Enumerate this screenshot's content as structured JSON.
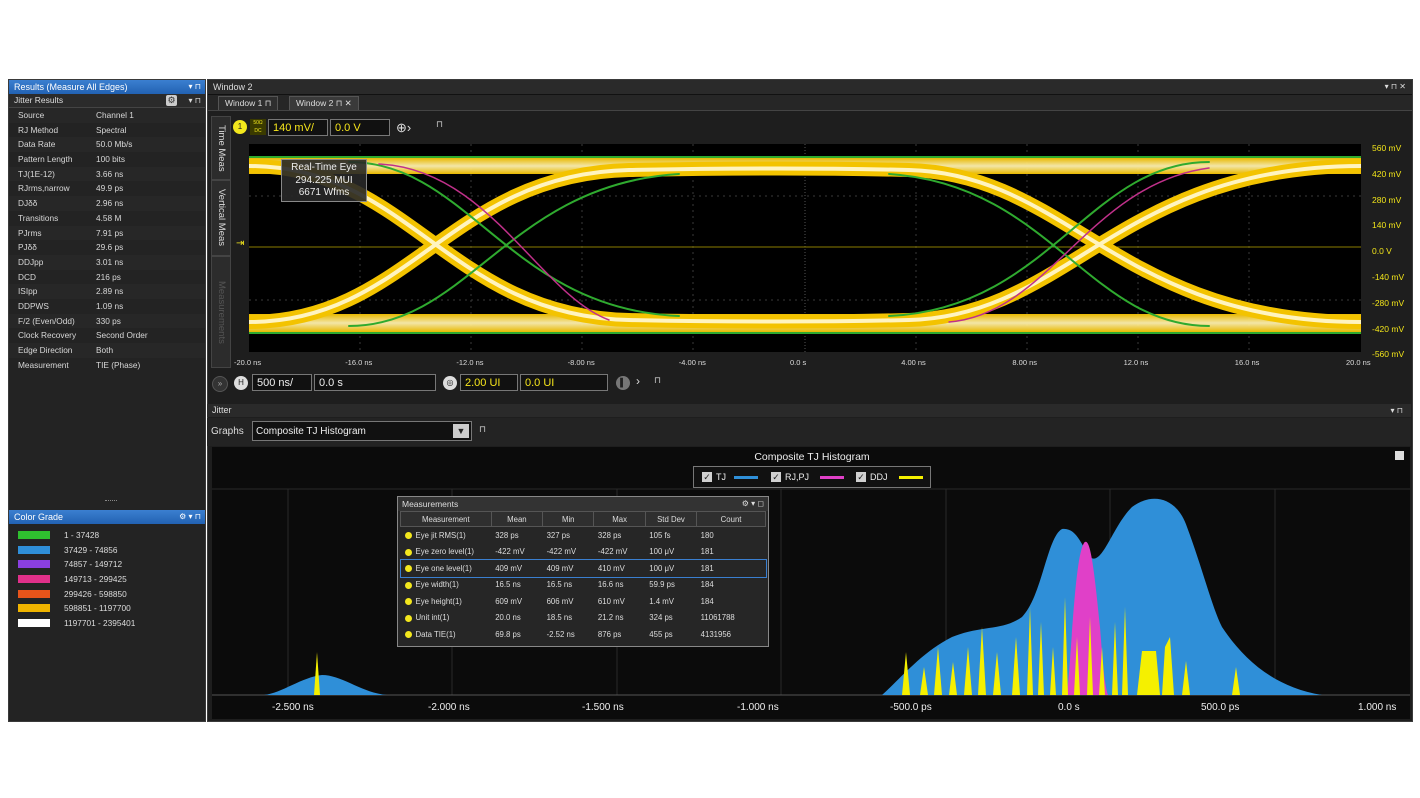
{
  "results_panel": {
    "title": "Results  (Measure All Edges)",
    "subheader": "Jitter Results",
    "rows": [
      {
        "label": "Source",
        "value": "Channel 1"
      },
      {
        "label": "RJ Method",
        "value": "Spectral"
      },
      {
        "label": "Data Rate",
        "value": "50.0 Mb/s"
      },
      {
        "label": "Pattern Length",
        "value": "100 bits"
      },
      {
        "label": "TJ(1E-12)",
        "value": "3.66 ns"
      },
      {
        "label": "RJrms,narrow",
        "value": "49.9 ps"
      },
      {
        "label": "DJδδ",
        "value": "2.96 ns"
      },
      {
        "label": "Transitions",
        "value": "4.58 M"
      },
      {
        "label": "PJrms",
        "value": "7.91 ps"
      },
      {
        "label": "PJδδ",
        "value": "29.6 ps"
      },
      {
        "label": "DDJpp",
        "value": "3.01 ns"
      },
      {
        "label": "DCD",
        "value": "216 ps"
      },
      {
        "label": "ISIpp",
        "value": "2.89 ns"
      },
      {
        "label": "DDPWS",
        "value": "1.09 ns"
      },
      {
        "label": "F/2 (Even/Odd)",
        "value": "330 ps"
      },
      {
        "label": "Clock Recovery",
        "value": "Second Order"
      },
      {
        "label": "Edge Direction",
        "value": "Both"
      },
      {
        "label": "Measurement",
        "value": "TIE (Phase)"
      }
    ]
  },
  "color_grade": {
    "title": "Color Grade",
    "rows": [
      {
        "range": "1 - 37428",
        "color": "#2fbf2f"
      },
      {
        "range": "37429 - 74856",
        "color": "#2f8fd8"
      },
      {
        "range": "74857 - 149712",
        "color": "#8a3fe0"
      },
      {
        "range": "149713 - 299425",
        "color": "#e0308a"
      },
      {
        "range": "299426 - 598850",
        "color": "#e8541a"
      },
      {
        "range": "598851 - 1197700",
        "color": "#f0b400"
      },
      {
        "range": "1197701 - 2395401",
        "color": "#ffffff"
      }
    ]
  },
  "window": {
    "title": "Window 2",
    "tabs": [
      "Window 1",
      "Window 2"
    ],
    "side_tabs": [
      "Time Meas",
      "Vertical Meas",
      "Measurements"
    ]
  },
  "scope": {
    "channel": "1",
    "coupling": "50Ω DC",
    "vscale": "140 mV/",
    "voffset": "0.0 V",
    "hscale": "500 ns/",
    "hpos": "0.0 s",
    "ui_scale": "2.00 UI",
    "ui_pos": "0.0 UI",
    "right_labels": [
      "560 mV",
      "420 mV",
      "280 mV",
      "140 mV",
      "0.0 V",
      "-140 mV",
      "-280 mV",
      "-420 mV",
      "-560 mV"
    ],
    "x_labels": [
      "-20.0 ns",
      "-16.0 ns",
      "-12.0 ns",
      "-8.00 ns",
      "-4.00 ns",
      "0.0 s",
      "4.00 ns",
      "8.00 ns",
      "12.0 ns",
      "16.0 ns",
      "20.0 ns"
    ],
    "eye_info": [
      "Real-Time Eye",
      "294.225 MUI",
      "6671 Wfms"
    ],
    "eye_color_accent": "#f3c300"
  },
  "jitter": {
    "title": "Jitter",
    "graphs_label": "Graphs",
    "graph_select": "Composite TJ Histogram",
    "chart_title": "Composite TJ Histogram",
    "legend": [
      {
        "name": "TJ",
        "color": "#2f8fd8"
      },
      {
        "name": "RJ,PJ",
        "color": "#e040c8"
      },
      {
        "name": "DDJ",
        "color": "#f5f000"
      }
    ],
    "x_labels": [
      "-2.500 ns",
      "-2.000 ns",
      "-1.500 ns",
      "-1.000 ns",
      "-500.0 ps",
      "0.0 s",
      "500.0 ps",
      "1.000 ns"
    ]
  },
  "measurements": {
    "title": "Measurements",
    "headers": [
      "Measurement",
      "Mean",
      "Min",
      "Max",
      "Std Dev",
      "Count"
    ],
    "rows": [
      [
        "Eye jit RMS(1)",
        "328 ps",
        "327 ps",
        "328 ps",
        "105 fs",
        "180"
      ],
      [
        "Eye zero level(1)",
        "-422 mV",
        "-422 mV",
        "-422 mV",
        "100 μV",
        "181"
      ],
      [
        "Eye one level(1)",
        "409 mV",
        "409 mV",
        "410 mV",
        "100 μV",
        "181"
      ],
      [
        "Eye width(1)",
        "16.5 ns",
        "16.5 ns",
        "16.6 ns",
        "59.9 ps",
        "184"
      ],
      [
        "Eye height(1)",
        "609 mV",
        "606 mV",
        "610 mV",
        "1.4 mV",
        "184"
      ],
      [
        "Unit int(1)",
        "20.0 ns",
        "18.5 ns",
        "21.2 ns",
        "324 ps",
        "11061788"
      ],
      [
        "Data TIE(1)",
        "69.8 ps",
        "-2.52 ns",
        "876 ps",
        "455 ps",
        "4131956"
      ]
    ]
  }
}
